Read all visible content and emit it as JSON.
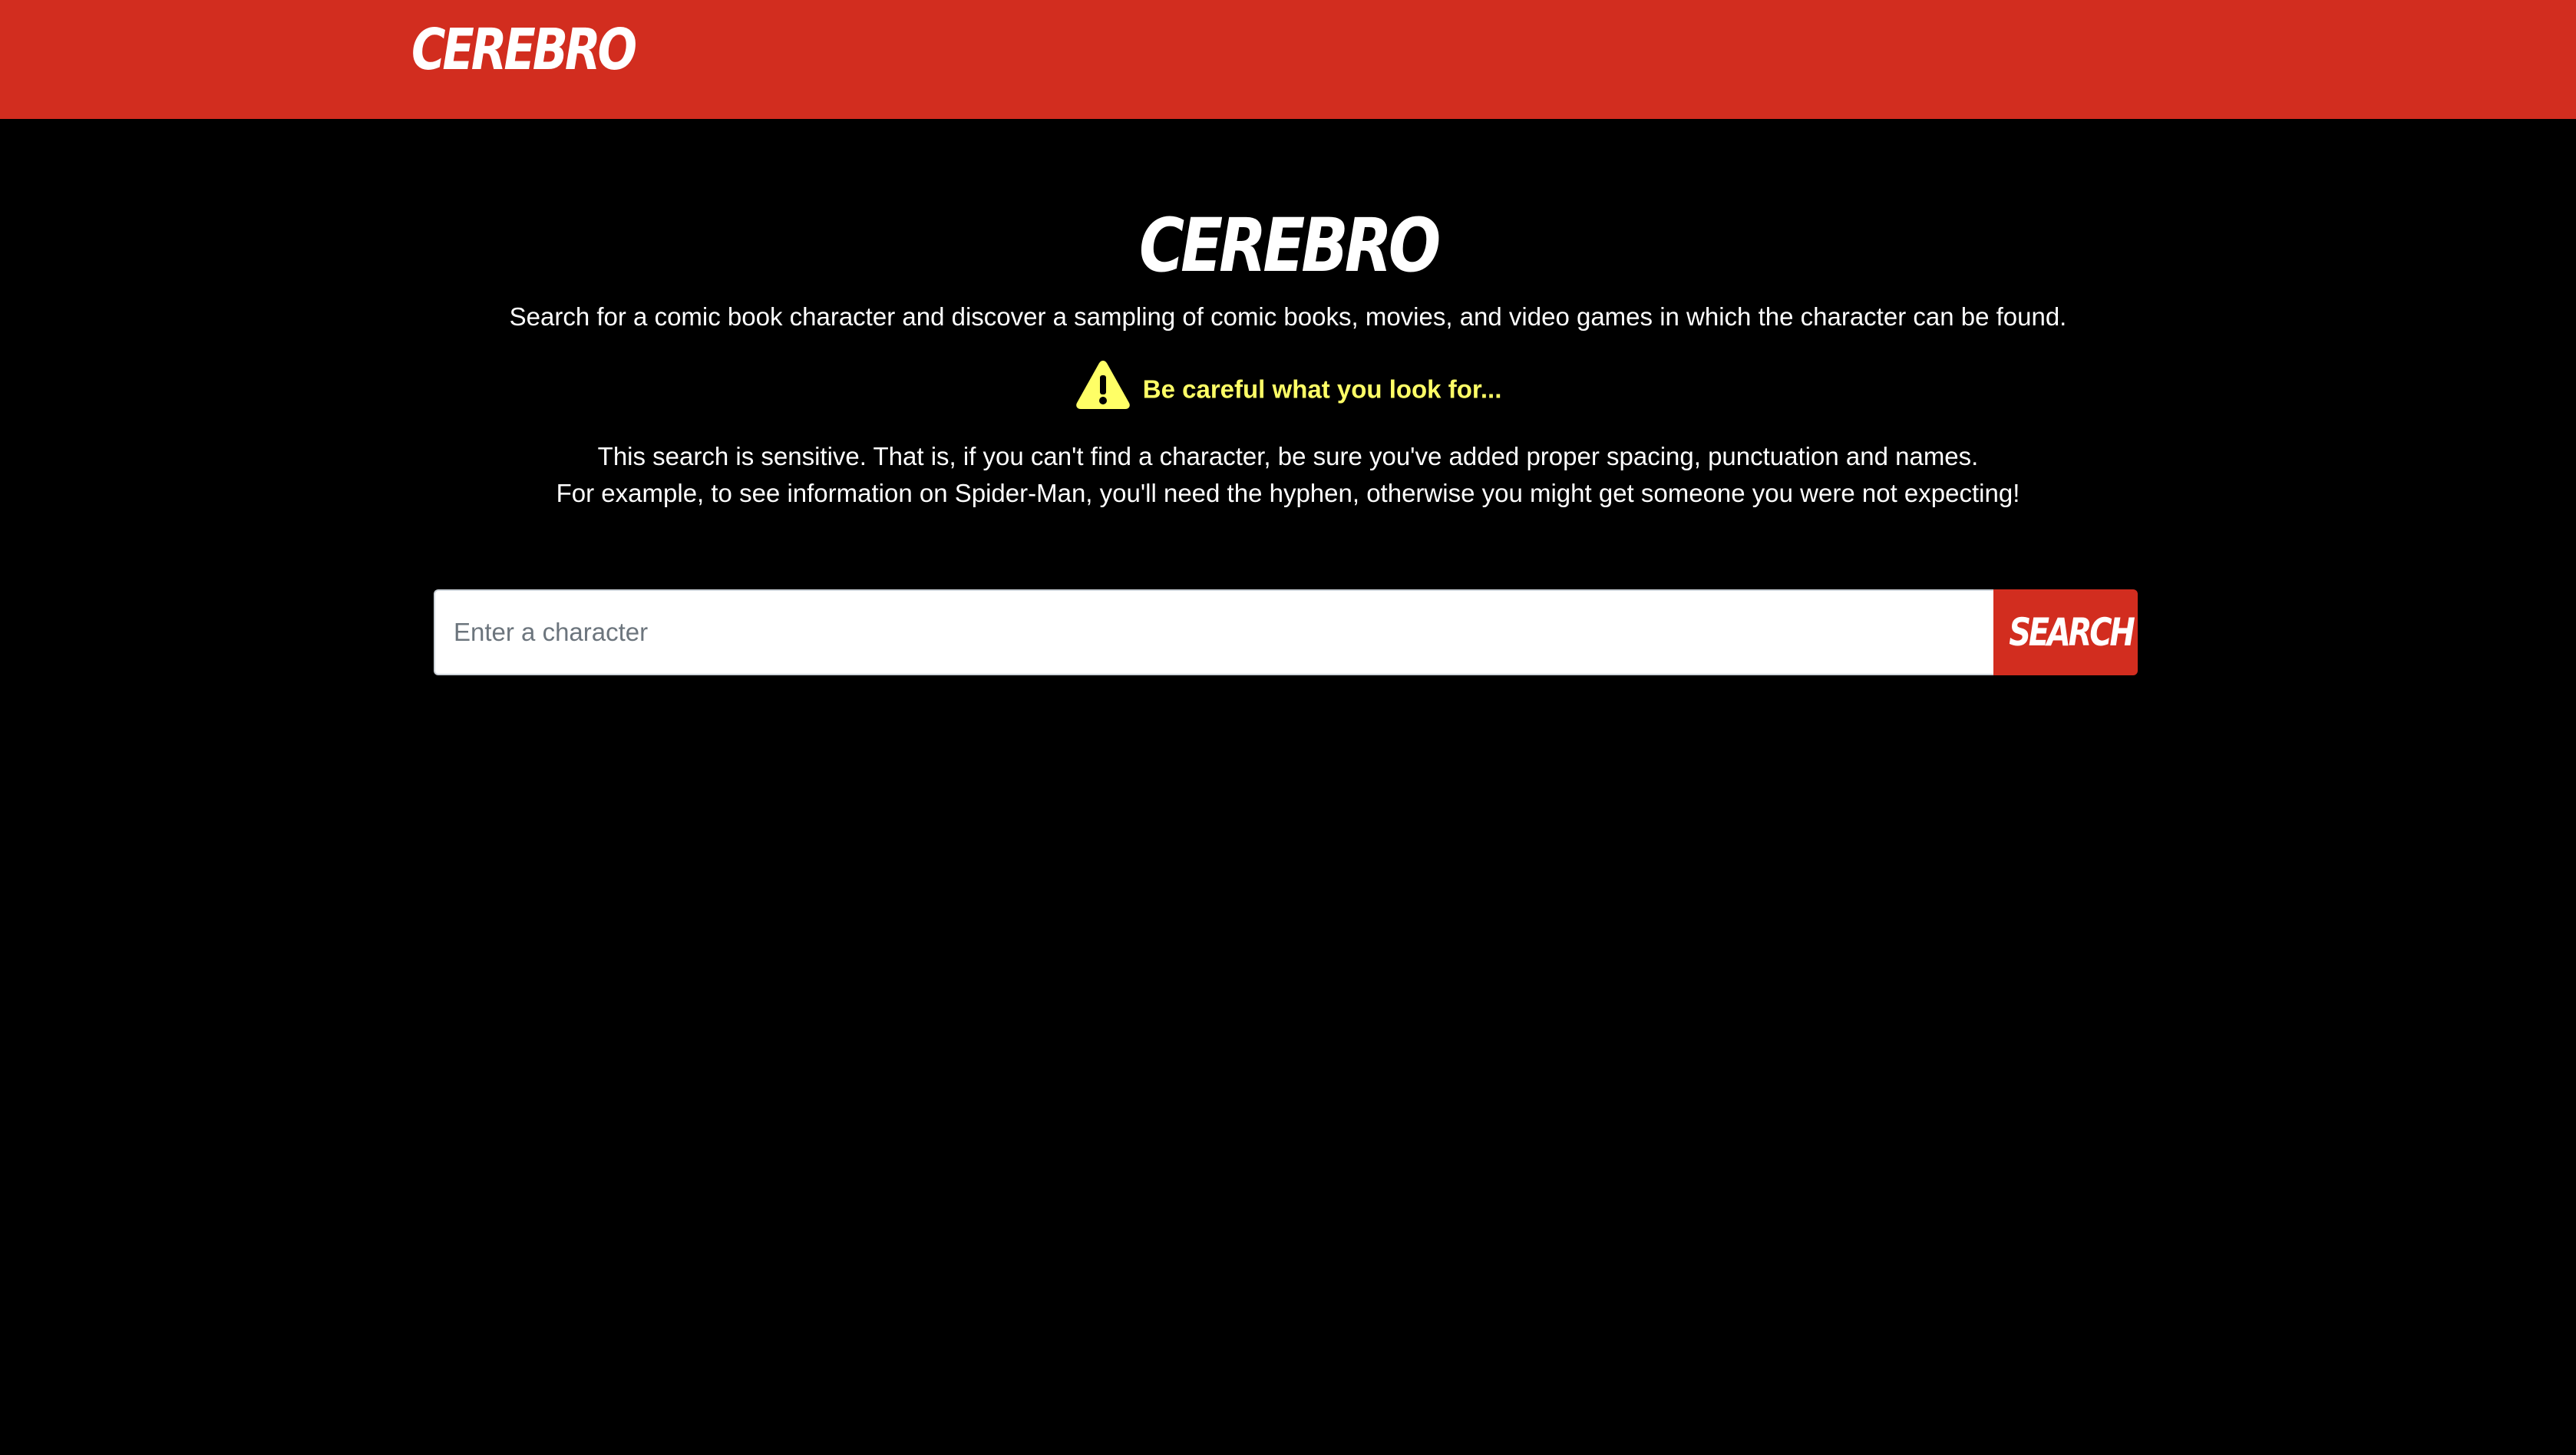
{
  "navbar": {
    "brand": "CEREBRO"
  },
  "hero": {
    "title": "CEREBRO",
    "lead": "Search for a comic book character and discover a sampling of comic books, movies, and video games in which the character can be found.",
    "warning_icon": "warning-triangle-icon",
    "warning": "Be careful what you look for...",
    "note_line1": "This search is sensitive. That is, if you can't find a character, be sure you've added proper spacing, punctuation and names.",
    "note_line2": "For example, to see information on Spider-Man, you'll need the hyphen, otherwise you might get someone you were not expecting!"
  },
  "search": {
    "placeholder": "Enter a character",
    "value": "",
    "button_label": "SEARCH"
  },
  "colors": {
    "brand_red": "#d22d1f",
    "background": "#000000",
    "warning_yellow": "#ffff66"
  }
}
